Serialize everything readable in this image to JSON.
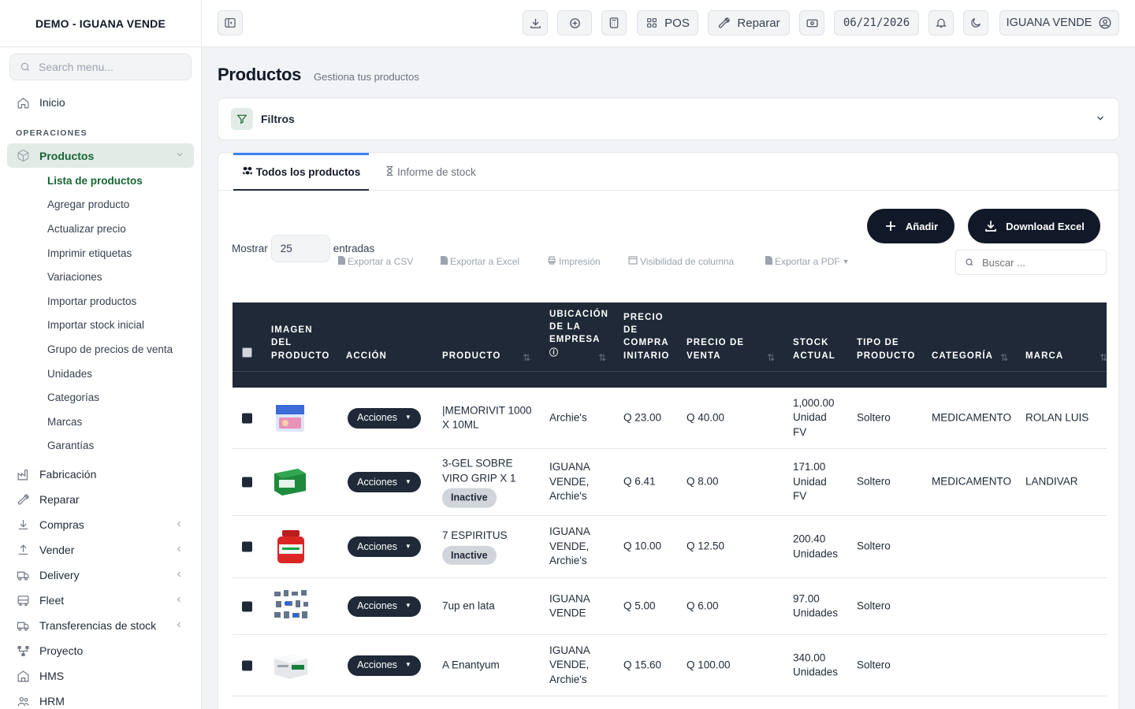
{
  "sidebar": {
    "brand": "DEMO - IGUANA VENDE",
    "search_placeholder": "Search menu...",
    "home": "Inicio",
    "section_operations": "OPERACIONES",
    "productos": "Productos",
    "sub_items": [
      "Lista de productos",
      "Agregar producto",
      "Actualizar precio",
      "Imprimir etiquetas",
      "Variaciones",
      "Importar productos",
      "Importar stock inicial",
      "Grupo de precios de venta",
      "Unidades",
      "Categorías",
      "Marcas",
      "Garantías"
    ],
    "items": [
      "Fabricación",
      "Reparar",
      "Compras",
      "Vender",
      "Delivery",
      "Fleet",
      "Transferencias de stock",
      "Proyecto",
      "HMS",
      "HRM"
    ]
  },
  "topbar": {
    "pos": "POS",
    "repair": "Reparar",
    "date": "06/21/2026",
    "user": "IGUANA VENDE"
  },
  "page": {
    "title": "Productos",
    "subtitle": "Gestiona tus productos",
    "filters": "Filtros"
  },
  "tabs": {
    "all": "Todos los productos",
    "stock": "Informe de stock"
  },
  "toolbar": {
    "show": "Mostrar",
    "entries_value": "25",
    "entries": "entradas",
    "csv": "Exportar a CSV",
    "excel": "Exportar a Excel",
    "print": "Impresión",
    "visibility": "Visibilidad de columna",
    "pdf": "Exportar a PDF",
    "add": "Añadir",
    "download": "Download Excel",
    "search_placeholder": "Buscar ..."
  },
  "table": {
    "headers": {
      "image": [
        "IMAGEN",
        "DEL",
        "PRODUCTO"
      ],
      "action": "ACCIÓN",
      "product": "PRODUCTO",
      "location": [
        "UBICACIÓN",
        "DE LA",
        "EMPRESA"
      ],
      "purchase": [
        "PRECIO",
        "DE",
        "COMPRA",
        "INITARIO"
      ],
      "sale": [
        "PRECIO DE",
        "VENTA"
      ],
      "stock": [
        "STOCK",
        "ACTUAL"
      ],
      "type": [
        "TIPO DE",
        "PRODUCTO"
      ],
      "category": "CATEGORÍA",
      "brand": "MARCA"
    },
    "action_label": "Acciones",
    "rows": [
      {
        "product": [
          "|MEMORIVIT 1000",
          "X 10ML"
        ],
        "badge": "",
        "location": [
          "Archie's"
        ],
        "purchase": "Q 23.00",
        "sale": "Q 40.00",
        "stock": [
          "1,000.00",
          "Unidad",
          "FV"
        ],
        "type": "Soltero",
        "category": "MEDICAMENTO",
        "brand": "ROLAN LUIS"
      },
      {
        "product": [
          "3-GEL SOBRE",
          "VIRO GRIP X 1"
        ],
        "badge": "Inactive",
        "location": [
          "IGUANA",
          "VENDE,",
          "Archie's"
        ],
        "purchase": "Q 6.41",
        "sale": "Q 8.00",
        "stock": [
          "171.00",
          "Unidad",
          "FV"
        ],
        "type": "Soltero",
        "category": "MEDICAMENTO",
        "brand": "LANDIVAR"
      },
      {
        "product": [
          "7 ESPIRITUS"
        ],
        "badge": "Inactive",
        "location": [
          "IGUANA",
          "VENDE,",
          "Archie's"
        ],
        "purchase": "Q 10.00",
        "sale": "Q 12.50",
        "stock": [
          "200.40",
          "Unidades"
        ],
        "type": "Soltero",
        "category": "",
        "brand": ""
      },
      {
        "product": [
          "7up en lata"
        ],
        "badge": "",
        "location": [
          "IGUANA",
          "VENDE"
        ],
        "purchase": "Q 5.00",
        "sale": "Q 6.00",
        "stock": [
          "97.00",
          "Unidades"
        ],
        "type": "Soltero",
        "category": "",
        "brand": ""
      },
      {
        "product": [
          "A Enantyum"
        ],
        "badge": "",
        "location": [
          "IGUANA",
          "VENDE,",
          "Archie's"
        ],
        "purchase": "Q 15.60",
        "sale": "Q 100.00",
        "stock": [
          "340.00",
          "Unidades"
        ],
        "type": "Soltero",
        "category": "",
        "brand": ""
      }
    ]
  },
  "colors": {
    "accent_green": "#166534",
    "dark": "#1f2937",
    "tab_indicator": "#3b82f6"
  }
}
